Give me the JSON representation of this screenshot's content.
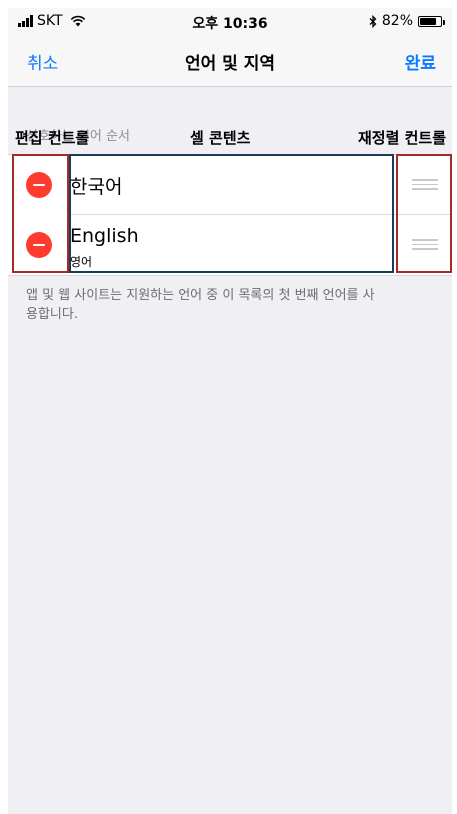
{
  "status_bar": {
    "carrier": "SKT",
    "time": "오후 10:36",
    "battery": "82%",
    "battery_level": 0.82,
    "icons": [
      "signal-icon",
      "wifi-icon",
      "bluetooth-icon",
      "battery-icon"
    ]
  },
  "nav": {
    "cancel": "취소",
    "title": "언어 및 지역",
    "done": "완료"
  },
  "section_header": "선호하는 언어 순서",
  "languages": [
    {
      "title": "한국어",
      "subtitle": ""
    },
    {
      "title": "English",
      "subtitle": "영어"
    }
  ],
  "annotations": {
    "edit_control": "편집 컨트롤",
    "cell_content": "셀 콘텐츠",
    "reorder_control": "재정렬 컨트롤"
  },
  "footer": "앱 및 웹 사이트는 지원하는 언어 중 이 목록의 첫 번째 언어를 사용합니다.",
  "colors": {
    "accent": "#0a7aff",
    "delete": "#ff3b30",
    "annotation_red": "#a52b2b",
    "annotation_blue": "#1d3b55"
  }
}
